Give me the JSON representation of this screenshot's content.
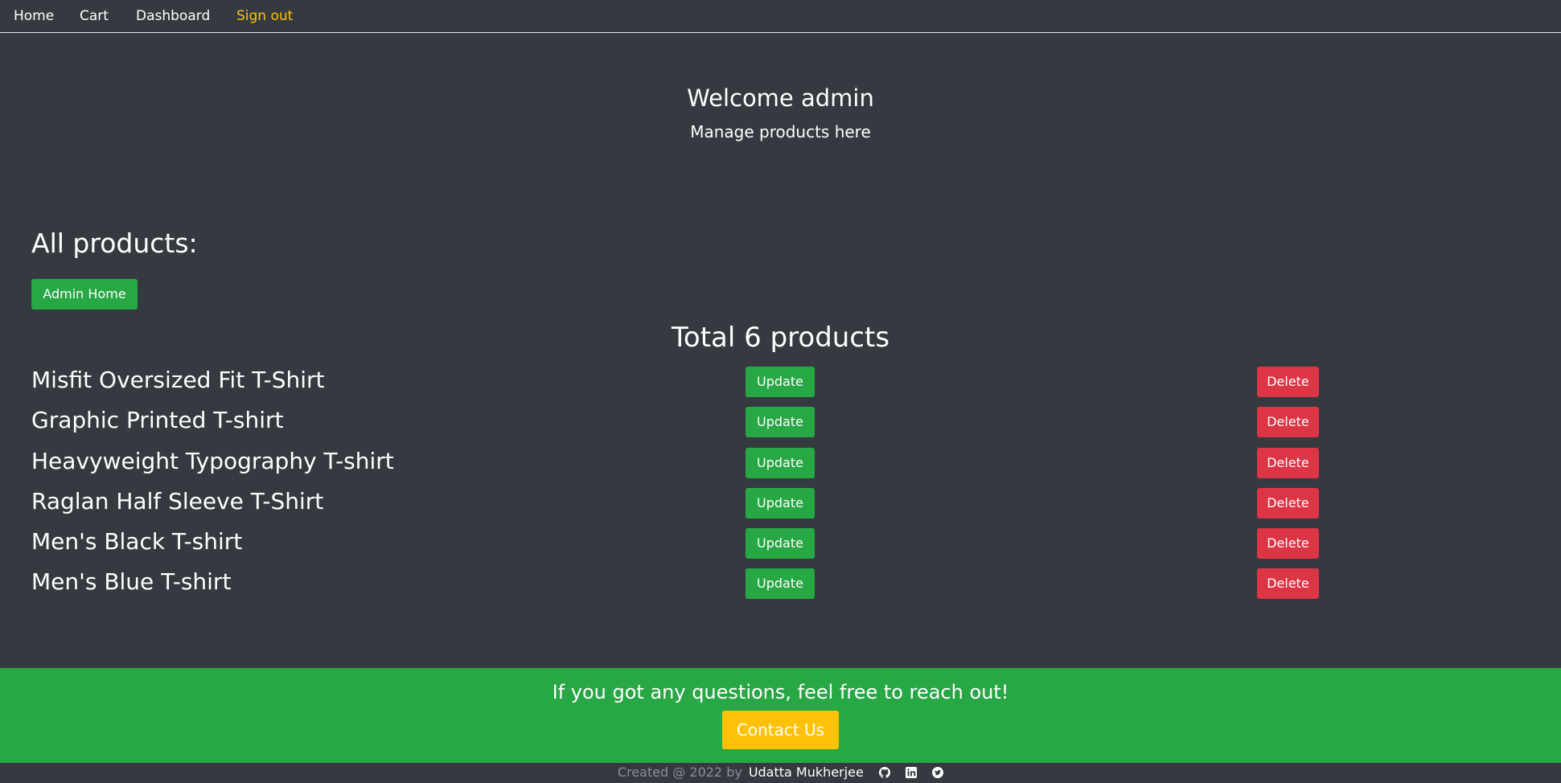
{
  "nav": {
    "home": "Home",
    "cart": "Cart",
    "dashboard": "Dashboard",
    "signout": "Sign out"
  },
  "hero": {
    "title": "Welcome admin",
    "subtitle": "Manage products here"
  },
  "products_section": {
    "title": "All products:",
    "admin_home_label": "Admin Home",
    "total_label": "Total 6 products",
    "update_label": "Update",
    "delete_label": "Delete",
    "items": [
      {
        "name": "Misfit Oversized Fit T-Shirt"
      },
      {
        "name": "Graphic Printed T-shirt"
      },
      {
        "name": "Heavyweight Typography T-shirt"
      },
      {
        "name": "Raglan Half Sleeve T-Shirt"
      },
      {
        "name": "Men's Black T-shirt"
      },
      {
        "name": "Men's Blue T-shirt"
      }
    ]
  },
  "footer": {
    "cta_text": "If you got any questions, feel free to reach out!",
    "contact_label": "Contact Us",
    "created_text": "Created @ 2022 by",
    "author": "Udatta Mukherjee",
    "social_icons": [
      "github-icon",
      "linkedin-icon",
      "twitter-icon"
    ]
  },
  "colors": {
    "background": "#343a40",
    "success": "#28a745",
    "danger": "#dc3545",
    "warning": "#ffc107"
  }
}
